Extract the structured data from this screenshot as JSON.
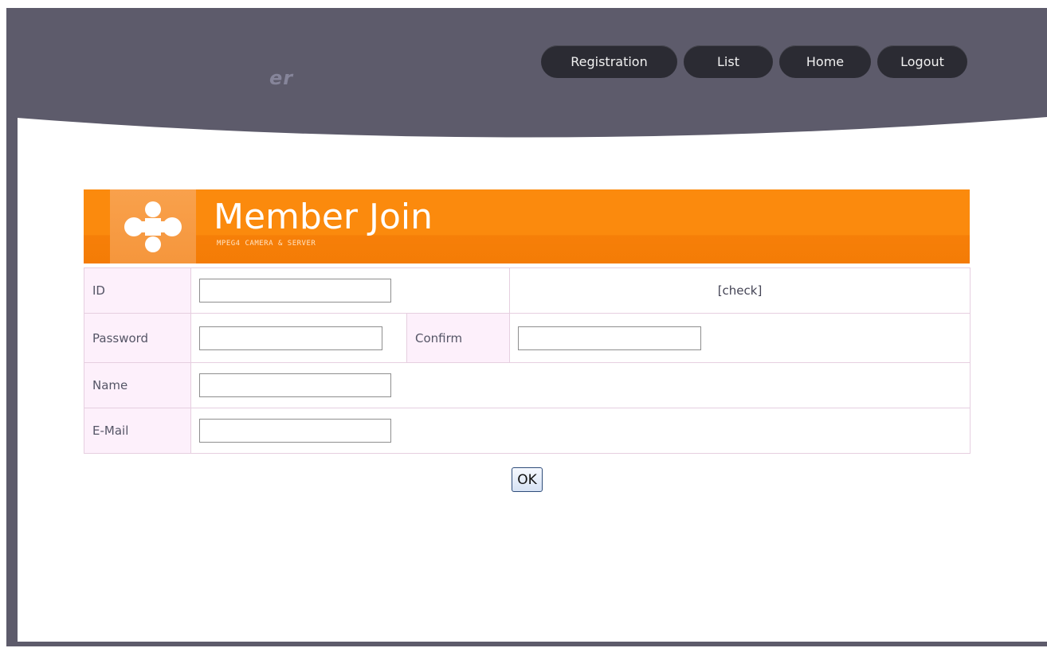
{
  "header": {
    "logo_fragment": "er",
    "nav": [
      {
        "label": "Registration"
      },
      {
        "label": "List"
      },
      {
        "label": "Home"
      },
      {
        "label": "Logout"
      }
    ]
  },
  "banner": {
    "title": "Member Join",
    "subtitle": "MPEG4 CAMERA & SERVER"
  },
  "form": {
    "id_label": "ID",
    "id_value": "",
    "check_label": "[check]",
    "password_label": "Password",
    "password_value": "",
    "confirm_label": "Confirm",
    "confirm_value": "",
    "name_label": "Name",
    "name_value": "",
    "email_label": "E-Mail",
    "email_value": "",
    "ok_label": "OK"
  },
  "colors": {
    "header_band": "#5d5b6b",
    "nav_button": "#2b2b33",
    "banner_orange": "#fb8a0d",
    "label_cell_bg": "#fdf0fb",
    "table_border": "#e6cfe0"
  },
  "icons": [
    "clover-logo-icon"
  ]
}
